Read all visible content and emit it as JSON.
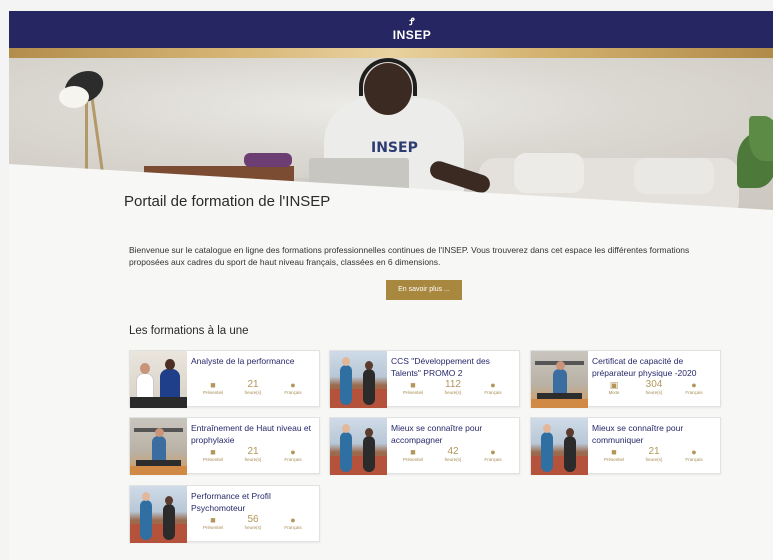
{
  "header": {
    "logo_text": "INSEP",
    "logo_mark": "Ꝭ"
  },
  "portal": {
    "title": "Portail de formation de l'INSEP",
    "intro": "Bienvenue sur le catalogue en ligne des formations professionnelles continues de l'INSEP. Vous trouverez dans cet espace les différentes formations proposées aux cadres du sport de haut niveau français, classées en 6 dimensions.",
    "more_button": "En savoir plus ..."
  },
  "section": {
    "title": "Les formations à la une"
  },
  "colors": {
    "navy": "#262663",
    "gold": "#a8873f",
    "card_title": "#26286a"
  },
  "meta_labels": {
    "hours_label": "heure(s)",
    "language": "Français"
  },
  "cards": [
    {
      "title": "Analyste de la performance",
      "mode": "Présentiel",
      "mode_icon": "people-icon",
      "hours": "21",
      "thumb": "office"
    },
    {
      "title": "CCS \"Développement des Talents\" PROMO 2",
      "mode": "Présentiel",
      "mode_icon": "people-icon",
      "hours": "112",
      "thumb": "track"
    },
    {
      "title": "Certificat de capacité de préparateur physique -2020",
      "mode": "Mixte",
      "mode_icon": "laptop-person-icon",
      "hours": "304",
      "thumb": "gym"
    },
    {
      "title": "Entraînement de Haut niveau et prophylaxie",
      "mode": "Présentiel",
      "mode_icon": "people-icon",
      "hours": "21",
      "thumb": "gym"
    },
    {
      "title": "Mieux se connaître pour accompagner",
      "mode": "Présentiel",
      "mode_icon": "people-icon",
      "hours": "42",
      "thumb": "track"
    },
    {
      "title": "Mieux se connaître pour communiquer",
      "mode": "Présentiel",
      "mode_icon": "people-icon",
      "hours": "21",
      "thumb": "track"
    },
    {
      "title": "Performance et Profil Psychomoteur",
      "mode": "Présentiel",
      "mode_icon": "people-icon",
      "hours": "56",
      "thumb": "track"
    }
  ]
}
